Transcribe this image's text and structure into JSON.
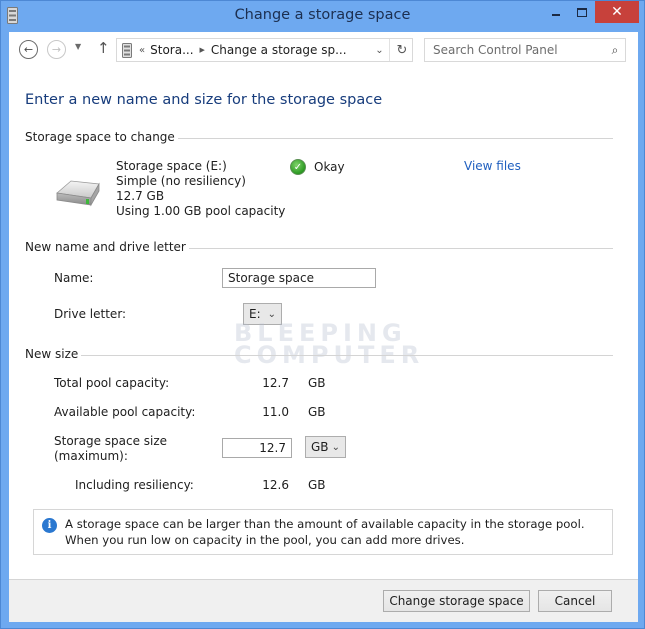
{
  "window": {
    "title": "Change a storage space",
    "close_glyph": "✕"
  },
  "nav": {
    "back_glyph": "←",
    "forward_glyph": "→",
    "recent_glyph": "▼",
    "up_glyph": "↑",
    "address": {
      "overflow": "«",
      "crumb": "Stora...",
      "separator": "▶",
      "current": "Change a storage sp...",
      "dropdown_glyph": "⌄",
      "refresh_glyph": "↻"
    },
    "search": {
      "placeholder": "Search Control Panel",
      "icon_glyph": "⌕"
    }
  },
  "page": {
    "title": "Enter a new name and size for the storage space"
  },
  "storage_space": {
    "header": "Storage space to change",
    "name": "Storage space (E:)",
    "resiliency": "Simple (no resiliency)",
    "size": "12.7 GB",
    "usage": "Using 1.00 GB pool capacity",
    "status": "Okay",
    "status_glyph": "✓",
    "view_files": "View files"
  },
  "name_section": {
    "header": "New name and drive letter",
    "name_label": "Name:",
    "name_value": "Storage space",
    "drive_label": "Drive letter:",
    "drive_value": "E:",
    "chevron": "⌄"
  },
  "size_section": {
    "header": "New size",
    "total_label": "Total pool capacity:",
    "total_value": "12.7",
    "total_unit": "GB",
    "available_label": "Available pool capacity:",
    "available_value": "11.0",
    "available_unit": "GB",
    "size_label_1": "Storage space size",
    "size_label_2": "(maximum):",
    "size_value": "12.7",
    "size_unit": "GB",
    "chevron": "⌄",
    "resiliency_label": "Including resiliency:",
    "resiliency_value": "12.6",
    "resiliency_unit": "GB"
  },
  "info": {
    "icon_glyph": "i",
    "text": "A storage space can be larger than the amount of available capacity in the storage pool. When you run low on capacity in the pool, you can add more drives."
  },
  "footer": {
    "primary_label": "Change storage space",
    "cancel_label": "Cancel"
  },
  "watermark": {
    "line1": "BLEEPING",
    "line2": "COMPUTER"
  }
}
